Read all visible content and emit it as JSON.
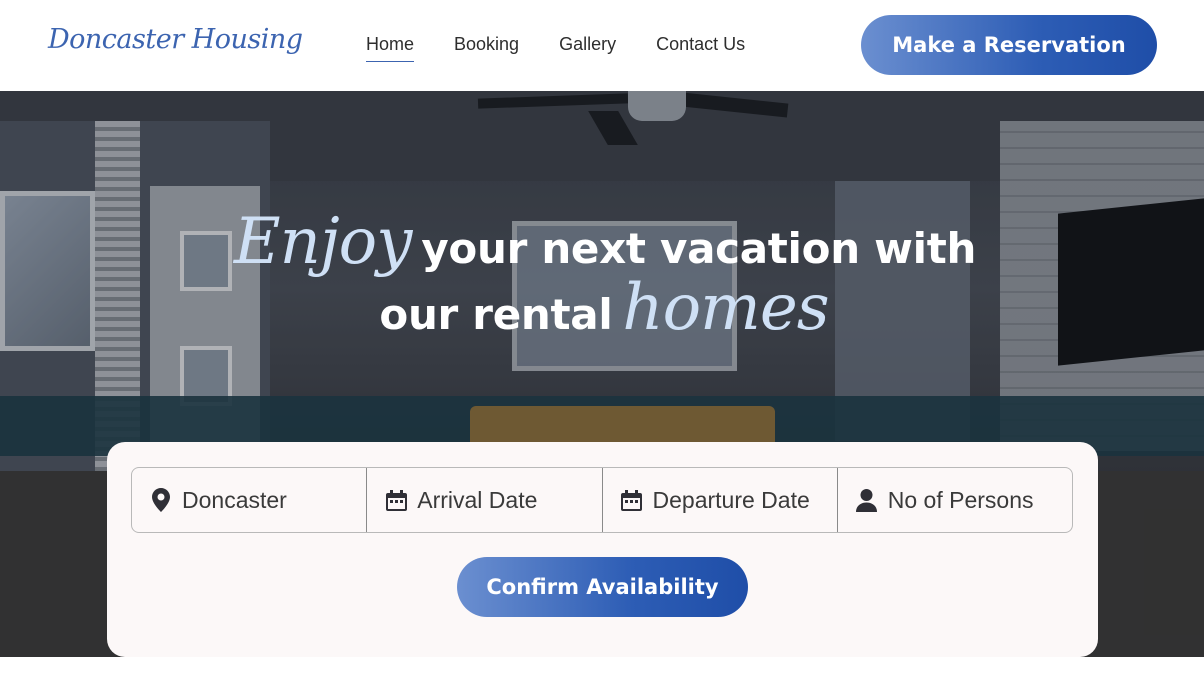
{
  "header": {
    "logo_text": "Doncaster Housing",
    "nav": [
      {
        "label": "Home",
        "active": true
      },
      {
        "label": "Booking",
        "active": false
      },
      {
        "label": "Gallery",
        "active": false
      },
      {
        "label": "Contact Us",
        "active": false
      }
    ],
    "cta_label": "Make a Reservation"
  },
  "hero": {
    "line1_script": "Enjoy",
    "line1_bold": "your next vacation with",
    "line2_bold": "our rental",
    "line2_script": "homes"
  },
  "booking": {
    "fields": [
      {
        "icon": "map-pin-icon",
        "text": "Doncaster"
      },
      {
        "icon": "calendar-icon",
        "text": "Arrival Date"
      },
      {
        "icon": "calendar-icon",
        "text": "Departure Date"
      },
      {
        "icon": "person-icon",
        "text": "No of Persons"
      }
    ],
    "confirm_label": "Confirm Availability"
  },
  "colors": {
    "accent": "#2d5db5",
    "accent_light": "#6b8fd0",
    "script_text": "#cfe0f5",
    "card_bg": "#fcf8f8"
  }
}
